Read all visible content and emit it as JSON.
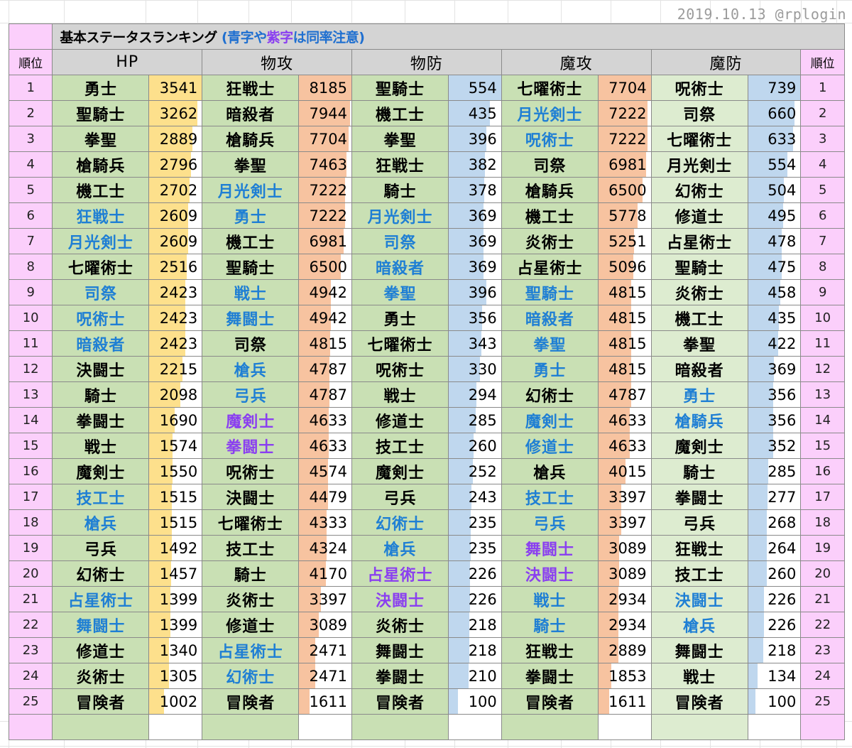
{
  "watermark": "2019.10.13 @rplogin",
  "title": {
    "main": "基本ステータスランキング ",
    "paren_open": "(",
    "blue1": "青字",
    "mid": "や",
    "purple1": "紫字",
    "tail": "は同率注意",
    "paren_close": ")"
  },
  "header": {
    "rank_left": "順位",
    "rank_right": "順位",
    "stats": [
      "HP",
      "物攻",
      "物防",
      "魔攻",
      "魔防"
    ]
  },
  "ranks": [
    "1",
    "2",
    "3",
    "4",
    "5",
    "6",
    "7",
    "8",
    "9",
    "10",
    "11",
    "12",
    "13",
    "14",
    "15",
    "16",
    "17",
    "18",
    "19",
    "20",
    "21",
    "22",
    "23",
    "24",
    "25"
  ],
  "colors": {
    "pink": "#fbcffb",
    "gray_header": "#d4d4d4",
    "green_name": "#c9e0b4",
    "green_name_light": "#ddecd0",
    "bar_yellow": "#fde08c",
    "bar_orange": "#f7c3a0",
    "bar_blue": "#bfd7ee",
    "text_blue": "#1f7fd4",
    "text_purple": "#8a3ff0"
  },
  "chart_data": {
    "type": "table",
    "title": "基本ステータスランキング",
    "columns": [
      "順位",
      "HP",
      "物攻",
      "物防",
      "魔攻",
      "魔防",
      "順位"
    ],
    "max_values": {
      "HP": 3541,
      "物攻": 8185,
      "物防": 554,
      "魔攻": 7704,
      "魔防": 739
    },
    "bar_colors": {
      "HP": "#fde08c",
      "物攻": "#f7c3a0",
      "物防": "#bfd7ee",
      "魔攻": "#f7c3a0",
      "魔防": "#bfd7ee"
    },
    "series": [
      {
        "name": "HP",
        "bar": "yellow",
        "name_bg": "green",
        "rows": [
          {
            "name": "勇士",
            "value": 3541,
            "color": "black"
          },
          {
            "name": "聖騎士",
            "value": 3262,
            "color": "black"
          },
          {
            "name": "拳聖",
            "value": 2889,
            "color": "black"
          },
          {
            "name": "槍騎兵",
            "value": 2796,
            "color": "black"
          },
          {
            "name": "機工士",
            "value": 2702,
            "color": "black"
          },
          {
            "name": "狂戦士",
            "value": 2609,
            "color": "blue"
          },
          {
            "name": "月光剣士",
            "value": 2609,
            "color": "blue"
          },
          {
            "name": "七曜術士",
            "value": 2516,
            "color": "black"
          },
          {
            "name": "司祭",
            "value": 2423,
            "color": "blue"
          },
          {
            "name": "呪術士",
            "value": 2423,
            "color": "blue"
          },
          {
            "name": "暗殺者",
            "value": 2423,
            "color": "blue"
          },
          {
            "name": "決闘士",
            "value": 2215,
            "color": "black"
          },
          {
            "name": "騎士",
            "value": 2098,
            "color": "black"
          },
          {
            "name": "拳闘士",
            "value": 1690,
            "color": "black"
          },
          {
            "name": "戦士",
            "value": 1574,
            "color": "black"
          },
          {
            "name": "魔剣士",
            "value": 1550,
            "color": "black"
          },
          {
            "name": "技工士",
            "value": 1515,
            "color": "blue"
          },
          {
            "name": "槍兵",
            "value": 1515,
            "color": "blue"
          },
          {
            "name": "弓兵",
            "value": 1492,
            "color": "black"
          },
          {
            "name": "幻術士",
            "value": 1457,
            "color": "black"
          },
          {
            "name": "占星術士",
            "value": 1399,
            "color": "blue"
          },
          {
            "name": "舞闘士",
            "value": 1399,
            "color": "blue"
          },
          {
            "name": "修道士",
            "value": 1340,
            "color": "black"
          },
          {
            "name": "炎術士",
            "value": 1305,
            "color": "black"
          },
          {
            "name": "冒険者",
            "value": 1002,
            "color": "black"
          }
        ]
      },
      {
        "name": "物攻",
        "bar": "orange",
        "name_bg": "green",
        "rows": [
          {
            "name": "狂戦士",
            "value": 8185,
            "color": "black"
          },
          {
            "name": "暗殺者",
            "value": 7944,
            "color": "black"
          },
          {
            "name": "槍騎兵",
            "value": 7704,
            "color": "black"
          },
          {
            "name": "拳聖",
            "value": 7463,
            "color": "black"
          },
          {
            "name": "月光剣士",
            "value": 7222,
            "color": "blue"
          },
          {
            "name": "勇士",
            "value": 7222,
            "color": "blue"
          },
          {
            "name": "機工士",
            "value": 6981,
            "color": "black"
          },
          {
            "name": "聖騎士",
            "value": 6500,
            "color": "black"
          },
          {
            "name": "戦士",
            "value": 4942,
            "color": "blue"
          },
          {
            "name": "舞闘士",
            "value": 4942,
            "color": "blue"
          },
          {
            "name": "司祭",
            "value": 4815,
            "color": "black"
          },
          {
            "name": "槍兵",
            "value": 4787,
            "color": "blue"
          },
          {
            "name": "弓兵",
            "value": 4787,
            "color": "blue"
          },
          {
            "name": "魔剣士",
            "value": 4633,
            "color": "purple"
          },
          {
            "name": "拳闘士",
            "value": 4633,
            "color": "purple"
          },
          {
            "name": "呪術士",
            "value": 4574,
            "color": "black"
          },
          {
            "name": "決闘士",
            "value": 4479,
            "color": "black"
          },
          {
            "name": "七曜術士",
            "value": 4333,
            "color": "black"
          },
          {
            "name": "技工士",
            "value": 4324,
            "color": "black"
          },
          {
            "name": "騎士",
            "value": 4170,
            "color": "black"
          },
          {
            "name": "炎術士",
            "value": 3397,
            "color": "black"
          },
          {
            "name": "修道士",
            "value": 3089,
            "color": "black"
          },
          {
            "name": "占星術士",
            "value": 2471,
            "color": "blue"
          },
          {
            "name": "幻術士",
            "value": 2471,
            "color": "blue"
          },
          {
            "name": "冒険者",
            "value": 1611,
            "color": "black"
          }
        ]
      },
      {
        "name": "物防",
        "bar": "blue",
        "name_bg": "green",
        "rows": [
          {
            "name": "聖騎士",
            "value": 554,
            "color": "black"
          },
          {
            "name": "機工士",
            "value": 435,
            "color": "black"
          },
          {
            "name": "拳聖",
            "value": 396,
            "color": "black"
          },
          {
            "name": "狂戦士",
            "value": 382,
            "color": "black"
          },
          {
            "name": "騎士",
            "value": 378,
            "color": "black"
          },
          {
            "name": "月光剣士",
            "value": 369,
            "color": "blue"
          },
          {
            "name": "司祭",
            "value": 369,
            "color": "blue"
          },
          {
            "name": "暗殺者",
            "value": 369,
            "color": "blue"
          },
          {
            "name": "拳聖",
            "value": 396,
            "color": "blue"
          },
          {
            "name": "勇士",
            "value": 356,
            "color": "black"
          },
          {
            "name": "七曜術士",
            "value": 343,
            "color": "black"
          },
          {
            "name": "呪術士",
            "value": 330,
            "color": "black"
          },
          {
            "name": "戦士",
            "value": 294,
            "color": "black"
          },
          {
            "name": "修道士",
            "value": 285,
            "color": "black"
          },
          {
            "name": "技工士",
            "value": 260,
            "color": "black"
          },
          {
            "name": "魔剣士",
            "value": 252,
            "color": "black"
          },
          {
            "name": "弓兵",
            "value": 243,
            "color": "black"
          },
          {
            "name": "幻術士",
            "value": 235,
            "color": "blue"
          },
          {
            "name": "槍兵",
            "value": 235,
            "color": "blue"
          },
          {
            "name": "占星術士",
            "value": 226,
            "color": "purple"
          },
          {
            "name": "決闘士",
            "value": 226,
            "color": "purple"
          },
          {
            "name": "炎術士",
            "value": 218,
            "color": "black"
          },
          {
            "name": "舞闘士",
            "value": 218,
            "color": "black"
          },
          {
            "name": "拳闘士",
            "value": 210,
            "color": "black"
          },
          {
            "name": "冒険者",
            "value": 100,
            "color": "black"
          }
        ]
      },
      {
        "name": "魔攻",
        "bar": "orange",
        "name_bg": "green",
        "rows": [
          {
            "name": "七曜術士",
            "value": 7704,
            "color": "black"
          },
          {
            "name": "月光剣士",
            "value": 7222,
            "color": "blue"
          },
          {
            "name": "呪術士",
            "value": 7222,
            "color": "blue"
          },
          {
            "name": "司祭",
            "value": 6981,
            "color": "black"
          },
          {
            "name": "槍騎兵",
            "value": 6500,
            "color": "black"
          },
          {
            "name": "機工士",
            "value": 5778,
            "color": "black"
          },
          {
            "name": "炎術士",
            "value": 5251,
            "color": "black"
          },
          {
            "name": "占星術士",
            "value": 5096,
            "color": "black"
          },
          {
            "name": "聖騎士",
            "value": 4815,
            "color": "blue"
          },
          {
            "name": "暗殺者",
            "value": 4815,
            "color": "blue"
          },
          {
            "name": "拳聖",
            "value": 4815,
            "color": "blue"
          },
          {
            "name": "勇士",
            "value": 4815,
            "color": "blue"
          },
          {
            "name": "幻術士",
            "value": 4787,
            "color": "black"
          },
          {
            "name": "魔剣士",
            "value": 4633,
            "color": "blue"
          },
          {
            "name": "修道士",
            "value": 4633,
            "color": "blue"
          },
          {
            "name": "槍兵",
            "value": 4015,
            "color": "black"
          },
          {
            "name": "技工士",
            "value": 3397,
            "color": "blue"
          },
          {
            "name": "弓兵",
            "value": 3397,
            "color": "blue"
          },
          {
            "name": "舞闘士",
            "value": 3089,
            "color": "purple"
          },
          {
            "name": "決闘士",
            "value": 3089,
            "color": "purple"
          },
          {
            "name": "戦士",
            "value": 2934,
            "color": "blue"
          },
          {
            "name": "騎士",
            "value": 2934,
            "color": "blue"
          },
          {
            "name": "狂戦士",
            "value": 2889,
            "color": "black"
          },
          {
            "name": "拳闘士",
            "value": 1853,
            "color": "black"
          },
          {
            "name": "冒険者",
            "value": 1611,
            "color": "black"
          }
        ]
      },
      {
        "name": "魔防",
        "bar": "blue",
        "name_bg": "green_light",
        "rows": [
          {
            "name": "呪術士",
            "value": 739,
            "color": "black"
          },
          {
            "name": "司祭",
            "value": 660,
            "color": "black"
          },
          {
            "name": "七曜術士",
            "value": 633,
            "color": "black"
          },
          {
            "name": "月光剣士",
            "value": 554,
            "color": "black"
          },
          {
            "name": "幻術士",
            "value": 504,
            "color": "black"
          },
          {
            "name": "修道士",
            "value": 495,
            "color": "black"
          },
          {
            "name": "占星術士",
            "value": 478,
            "color": "black"
          },
          {
            "name": "聖騎士",
            "value": 475,
            "color": "black"
          },
          {
            "name": "炎術士",
            "value": 458,
            "color": "black"
          },
          {
            "name": "機工士",
            "value": 435,
            "color": "black"
          },
          {
            "name": "拳聖",
            "value": 422,
            "color": "black"
          },
          {
            "name": "暗殺者",
            "value": 369,
            "color": "black"
          },
          {
            "name": "勇士",
            "value": 356,
            "color": "blue"
          },
          {
            "name": "槍騎兵",
            "value": 356,
            "color": "blue"
          },
          {
            "name": "魔剣士",
            "value": 352,
            "color": "black"
          },
          {
            "name": "騎士",
            "value": 285,
            "color": "black"
          },
          {
            "name": "拳闘士",
            "value": 277,
            "color": "black"
          },
          {
            "name": "弓兵",
            "value": 268,
            "color": "black"
          },
          {
            "name": "狂戦士",
            "value": 264,
            "color": "black"
          },
          {
            "name": "技工士",
            "value": 260,
            "color": "black"
          },
          {
            "name": "決闘士",
            "value": 226,
            "color": "blue"
          },
          {
            "name": "槍兵",
            "value": 226,
            "color": "blue"
          },
          {
            "name": "舞闘士",
            "value": 218,
            "color": "black"
          },
          {
            "name": "戦士",
            "value": 134,
            "color": "black"
          },
          {
            "name": "冒険者",
            "value": 100,
            "color": "black"
          }
        ]
      }
    ]
  }
}
